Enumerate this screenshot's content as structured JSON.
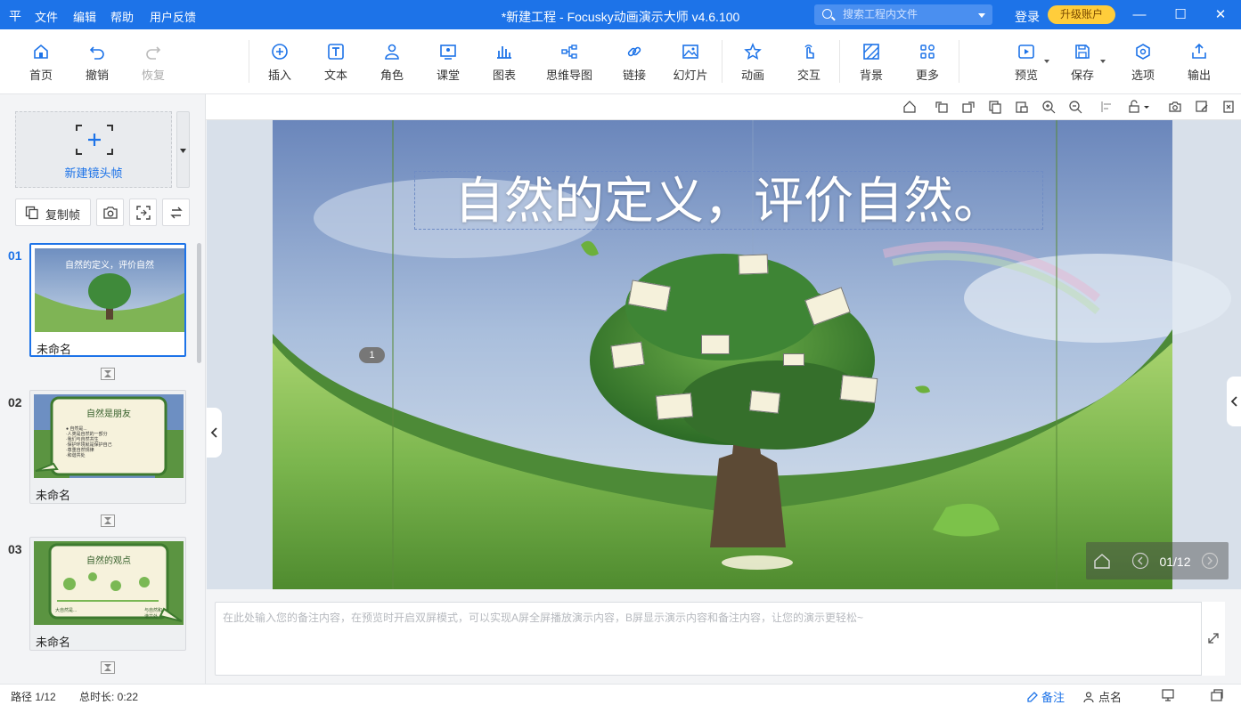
{
  "titlebar": {
    "logo": "平",
    "menu": [
      "文件",
      "编辑",
      "帮助",
      "用户反馈"
    ],
    "title": "*新建工程 - Focusky动画演示大师  v4.6.100",
    "search_placeholder": "搜索工程内文件",
    "login": "登录",
    "upgrade": "升级账户",
    "win_min": "—",
    "win_max": "☐",
    "win_close": "✕"
  },
  "toolbar": {
    "home": "首页",
    "undo": "撤销",
    "redo": "恢复",
    "insert": "插入",
    "text": "文本",
    "role": "角色",
    "classroom": "课堂",
    "chart": "图表",
    "mindmap": "思维导图",
    "link": "链接",
    "slideshow": "幻灯片",
    "animation": "动画",
    "interaction": "交互",
    "background": "背景",
    "more": "更多",
    "preview": "预览",
    "save": "保存",
    "options": "选项",
    "export": "输出"
  },
  "left_panel": {
    "new_frame": "新建镜头帧",
    "copy_frame": "复制帧",
    "slides": [
      {
        "num": "01",
        "name": "未命名",
        "thumb_title": "自然的定义，评价自然"
      },
      {
        "num": "02",
        "name": "未命名",
        "thumb_title": "自然是朋友",
        "thumb_lines": [
          "● 自然是...",
          "·人类是自然的一部分",
          "·我们与自然共生",
          "·保护环境就是保护自己",
          "·尊重自然规律",
          "·和谐共处"
        ]
      },
      {
        "num": "03",
        "name": "未命名",
        "thumb_title": "自然的观点",
        "thumb_left": "大自然是...",
        "thumb_right": "与自然和谐共处"
      }
    ]
  },
  "canvas": {
    "title": "自然的定义，评价自然。",
    "path_marker": "1",
    "counter": "01/12"
  },
  "notes": {
    "placeholder": "在此处输入您的备注内容，在预览时开启双屏模式，可以实现A屏全屏播放演示内容，B屏显示演示内容和备注内容，让您的演示更轻松~"
  },
  "statusbar": {
    "path": "路径 1/12",
    "duration": "总时长: 0:22",
    "notes": "备注",
    "rollcall": "点名"
  },
  "colors": {
    "accent": "#1d73e8",
    "upgrade": "#ffcd3b"
  }
}
